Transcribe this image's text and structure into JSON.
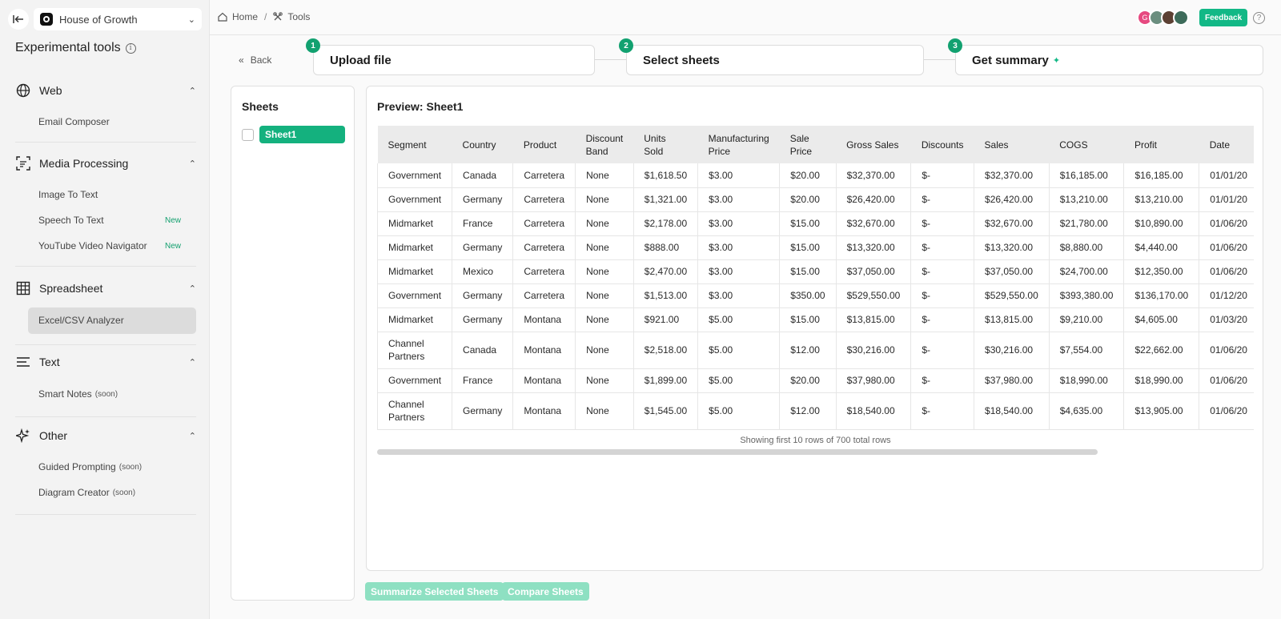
{
  "workspace": {
    "name": "House of Growth"
  },
  "sidebar": {
    "title": "Experimental tools",
    "sections": [
      {
        "label": "Web",
        "icon": "globe-icon",
        "items": [
          {
            "label": "Email Composer"
          }
        ]
      },
      {
        "label": "Media Processing",
        "icon": "media-scan-icon",
        "items": [
          {
            "label": "Image To Text"
          },
          {
            "label": "Speech To Text",
            "badge": "New"
          },
          {
            "label": "YouTube Video Navigator",
            "badge": "New"
          }
        ]
      },
      {
        "label": "Spreadsheet",
        "icon": "table-grid-icon",
        "items": [
          {
            "label": "Excel/CSV Analyzer",
            "active": true
          }
        ]
      },
      {
        "label": "Text",
        "icon": "text-lines-icon",
        "items": [
          {
            "label": "Smart Notes",
            "suffix": "(soon)"
          }
        ]
      },
      {
        "label": "Other",
        "icon": "sparkles-icon",
        "items": [
          {
            "label": "Guided Prompting",
            "suffix": "(soon)"
          },
          {
            "label": "Diagram Creator",
            "suffix": "(soon)"
          }
        ]
      }
    ]
  },
  "breadcrumb": {
    "home": "Home",
    "sep": "/",
    "tools": "Tools"
  },
  "header": {
    "feedback": "Feedback",
    "help": "?",
    "avatar_initial": "G"
  },
  "steps": {
    "back": "Back",
    "items": [
      {
        "num": "1",
        "label": "Upload file"
      },
      {
        "num": "2",
        "label": "Select sheets"
      },
      {
        "num": "3",
        "label": "Get summary"
      }
    ]
  },
  "sheets": {
    "title": "Sheets",
    "list": [
      "Sheet1"
    ]
  },
  "preview": {
    "title": "Preview: Sheet1",
    "columns": [
      "Segment",
      "Country",
      "Product",
      "Discount Band",
      "Units Sold",
      "Manufacturing Price",
      "Sale Price",
      "Gross Sales",
      "Discounts",
      "Sales",
      "COGS",
      "Profit",
      "Date"
    ],
    "rows": [
      [
        "Government",
        "Canada",
        "Carretera",
        "None",
        "$1,618.50",
        "$3.00",
        "$20.00",
        "$32,370.00",
        "$-",
        "$32,370.00",
        "$16,185.00",
        "$16,185.00",
        "01/01/20"
      ],
      [
        "Government",
        "Germany",
        "Carretera",
        "None",
        "$1,321.00",
        "$3.00",
        "$20.00",
        "$26,420.00",
        "$-",
        "$26,420.00",
        "$13,210.00",
        "$13,210.00",
        "01/01/20"
      ],
      [
        "Midmarket",
        "France",
        "Carretera",
        "None",
        "$2,178.00",
        "$3.00",
        "$15.00",
        "$32,670.00",
        "$-",
        "$32,670.00",
        "$21,780.00",
        "$10,890.00",
        "01/06/20"
      ],
      [
        "Midmarket",
        "Germany",
        "Carretera",
        "None",
        "$888.00",
        "$3.00",
        "$15.00",
        "$13,320.00",
        "$-",
        "$13,320.00",
        "$8,880.00",
        "$4,440.00",
        "01/06/20"
      ],
      [
        "Midmarket",
        "Mexico",
        "Carretera",
        "None",
        "$2,470.00",
        "$3.00",
        "$15.00",
        "$37,050.00",
        "$-",
        "$37,050.00",
        "$24,700.00",
        "$12,350.00",
        "01/06/20"
      ],
      [
        "Government",
        "Germany",
        "Carretera",
        "None",
        "$1,513.00",
        "$3.00",
        "$350.00",
        "$529,550.00",
        "$-",
        "$529,550.00",
        "$393,380.00",
        "$136,170.00",
        "01/12/20"
      ],
      [
        "Midmarket",
        "Germany",
        "Montana",
        "None",
        "$921.00",
        "$5.00",
        "$15.00",
        "$13,815.00",
        "$-",
        "$13,815.00",
        "$9,210.00",
        "$4,605.00",
        "01/03/20"
      ],
      [
        "Channel Partners",
        "Canada",
        "Montana",
        "None",
        "$2,518.00",
        "$5.00",
        "$12.00",
        "$30,216.00",
        "$-",
        "$30,216.00",
        "$7,554.00",
        "$22,662.00",
        "01/06/20"
      ],
      [
        "Government",
        "France",
        "Montana",
        "None",
        "$1,899.00",
        "$5.00",
        "$20.00",
        "$37,980.00",
        "$-",
        "$37,980.00",
        "$18,990.00",
        "$18,990.00",
        "01/06/20"
      ],
      [
        "Channel Partners",
        "Germany",
        "Montana",
        "None",
        "$1,545.00",
        "$5.00",
        "$12.00",
        "$18,540.00",
        "$-",
        "$18,540.00",
        "$4,635.00",
        "$13,905.00",
        "01/06/20"
      ]
    ],
    "footer": "Showing first 10 rows of 700 total rows"
  },
  "actions": {
    "summarize": "Summarize Selected Sheets",
    "compare": "Compare Sheets"
  },
  "colors": {
    "accent": "#12b886",
    "accent_disabled": "#8ee0c2"
  }
}
